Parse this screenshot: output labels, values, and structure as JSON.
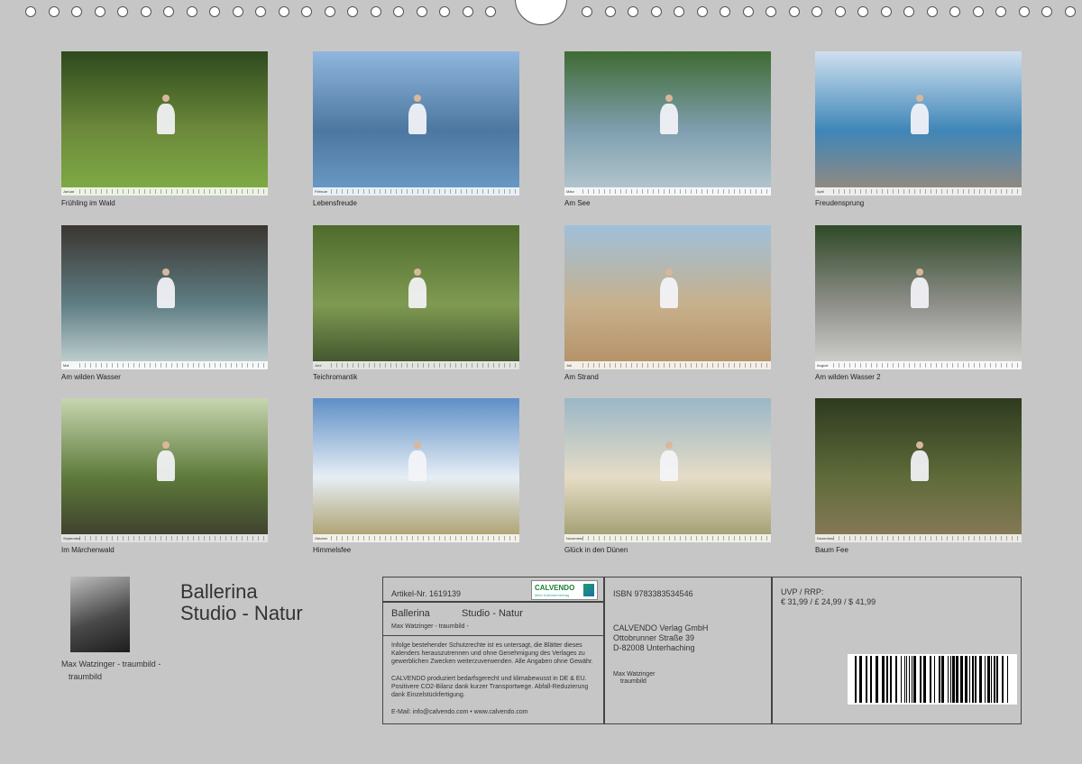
{
  "months": [
    {
      "caption": "Frühling im Wald",
      "month": "Januar",
      "colors": [
        "#2e4a1d",
        "#6d8a3b",
        "#7fae45"
      ]
    },
    {
      "caption": "Lebensfreude",
      "month": "Februar",
      "colors": [
        "#8fb6dd",
        "#4d77a0",
        "#6b9cc8"
      ]
    },
    {
      "caption": "Am See",
      "month": "März",
      "colors": [
        "#3f6b33",
        "#7f9fb0",
        "#b8c9cf"
      ]
    },
    {
      "caption": "Freudensprung",
      "month": "April",
      "colors": [
        "#cfe0ef",
        "#3f86b8",
        "#9a8a7a"
      ]
    },
    {
      "caption": "Am wilden Wasser",
      "month": "Mai",
      "colors": [
        "#3b3530",
        "#5f7e84",
        "#c9d7d8"
      ]
    },
    {
      "caption": "Teichromantik",
      "month": "Juni",
      "colors": [
        "#4e6b2c",
        "#7f9a52",
        "#3b4f2a"
      ]
    },
    {
      "caption": "Am Strand",
      "month": "Juli",
      "colors": [
        "#9fc0da",
        "#c7b08c",
        "#b38f66"
      ]
    },
    {
      "caption": "Am wilden Wasser 2",
      "month": "August",
      "colors": [
        "#2f4a28",
        "#8f8f8a",
        "#d5d5d2"
      ]
    },
    {
      "caption": "Im Märchenwald",
      "month": "September",
      "colors": [
        "#c7d6b0",
        "#5e7a3a",
        "#3b3b2e"
      ]
    },
    {
      "caption": "Himmelsfee",
      "month": "Oktober",
      "colors": [
        "#5f8fc6",
        "#e6eef5",
        "#a89a62"
      ]
    },
    {
      "caption": "Glück in den Dünen",
      "month": "November",
      "colors": [
        "#9ab7c7",
        "#e6dcc6",
        "#9c9a6a"
      ]
    },
    {
      "caption": "Baum Fee",
      "month": "Dezember",
      "colors": [
        "#2e3a1f",
        "#5f6b3a",
        "#8a7a5a"
      ]
    }
  ],
  "author": {
    "name_line1": "Max Watzinger - traumbild -",
    "name_line2": "traumbild"
  },
  "title": {
    "line1": "Ballerina",
    "line2": "Studio - Natur"
  },
  "box1": {
    "article": "Artikel-Nr. 1619139",
    "logo_text": "CALVENDO",
    "logo_sub": "Mein Kalendervertrag",
    "title_left": "Ballerina",
    "title_right": "Studio - Natur",
    "author": "Max Watzinger - traumbild -",
    "legal": "Infolge bestehender Schutzrechte ist es untersagt, die Blätter dieses Kalenders herauszutrennen und ohne Genehmigung des Verlages zu gewerblichen Zwecken weiterzuverwenden. Alle Angaben ohne Gewähr.",
    "eco": "CALVENDO produziert bedarfsgerecht und klimabewusst in DE & EU. Positivere CO2-Bilanz dank kurzer Transportwege. Abfall-Reduzierung dank Einzelstückfertigung.",
    "contact": "E-Mail: info@calvendo.com • www.calvendo.com"
  },
  "box2": {
    "isbn": "ISBN 9783383534546",
    "publisher": "CALVENDO Verlag GmbH",
    "street": "Ottobrunner Straße 39",
    "city": "D-82008 Unterhaching",
    "author1": "Max Watzinger",
    "author2": "traumbild"
  },
  "box3": {
    "uvp": "UVP / RRP:",
    "prices": "€ 31,99 / £ 24,99 / $ 41,99"
  }
}
